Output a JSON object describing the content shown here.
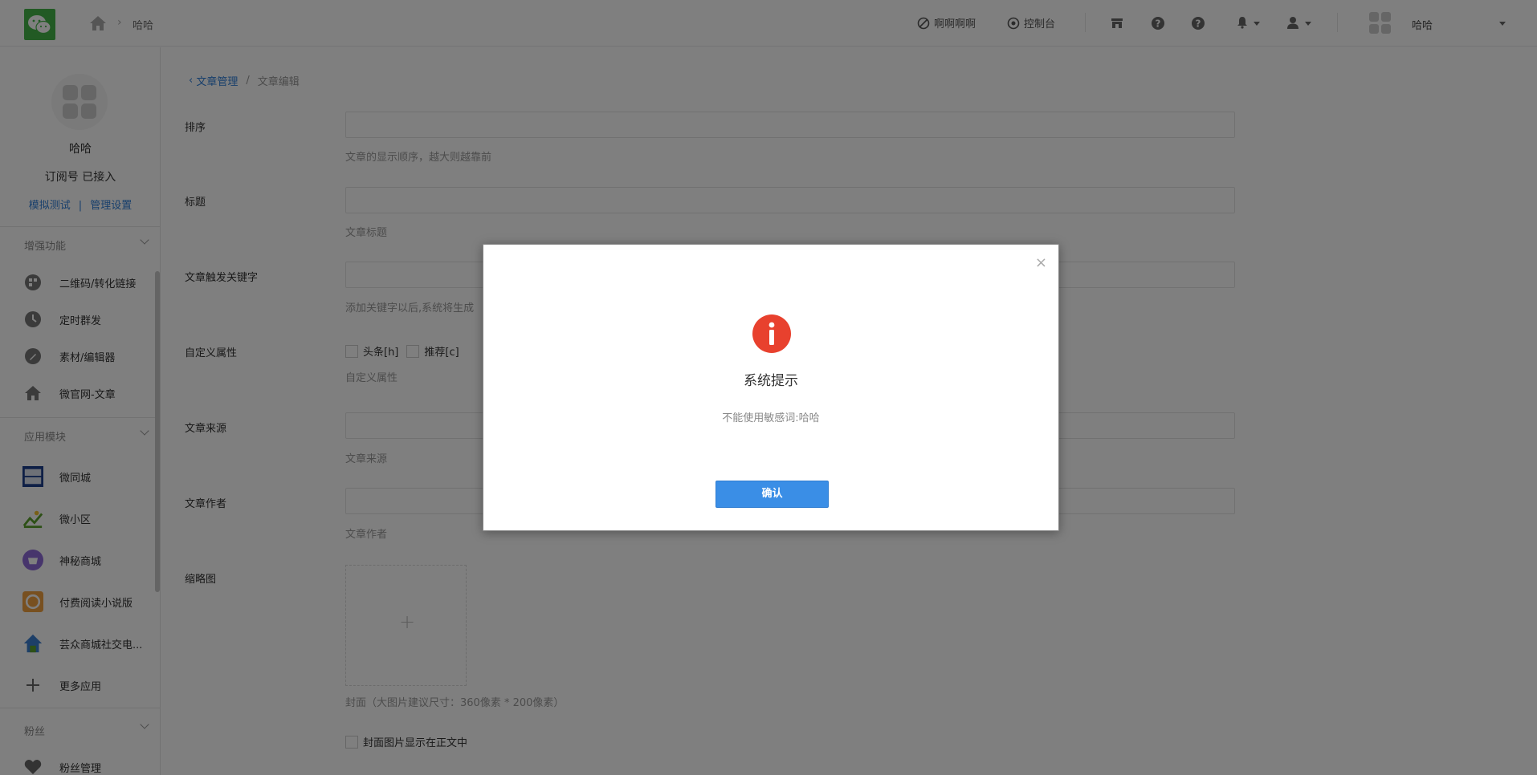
{
  "header": {
    "breadcrumb_current": "哈哈",
    "link_1": "啊啊啊啊",
    "link_2": "控制台",
    "account_name": "哈哈"
  },
  "sidebar": {
    "account_name": "哈哈",
    "account_type": "订阅号 已接入",
    "link_test": "模拟测试",
    "link_manage": "管理设置",
    "groups": [
      {
        "title": "增强功能",
        "items": [
          {
            "label": "二维码/转化链接",
            "icon": "qrcode-icon"
          },
          {
            "label": "定时群发",
            "icon": "clock-icon"
          },
          {
            "label": "素材/编辑器",
            "icon": "pencil-icon"
          },
          {
            "label": "微官网-文章",
            "icon": "home-icon"
          }
        ]
      },
      {
        "title": "应用模块",
        "items": [
          {
            "label": "微同城",
            "icon": "city-app-icon"
          },
          {
            "label": "微小区",
            "icon": "community-app-icon"
          },
          {
            "label": "神秘商城",
            "icon": "mall-app-icon"
          },
          {
            "label": "付费阅读小说版",
            "icon": "novel-app-icon"
          },
          {
            "label": "芸众商城社交电...",
            "icon": "shop-app-icon"
          },
          {
            "label": "更多应用",
            "icon": "plus-icon"
          }
        ]
      },
      {
        "title": "粉丝",
        "items": [
          {
            "label": "粉丝管理",
            "icon": "heart-icon"
          }
        ]
      }
    ]
  },
  "main": {
    "breadcrumb_back": "文章管理",
    "breadcrumb_sep": "/",
    "breadcrumb_current": "文章编辑",
    "fields": [
      {
        "label": "排序",
        "help": "文章的显示顺序，越大则越靠前"
      },
      {
        "label": "标题",
        "help": "文章标题"
      },
      {
        "label": "文章触发关键字",
        "help": "添加关键字以后,系统将生成"
      },
      {
        "label": "自定义属性",
        "help": "自定义属性"
      },
      {
        "label": "文章来源",
        "help": "文章来源"
      },
      {
        "label": "文章作者",
        "help": "文章作者"
      },
      {
        "label": "缩略图",
        "help": "封面（大图片建议尺寸：360像素 * 200像素）"
      }
    ],
    "checkboxes": [
      "头条[h]",
      "推荐[c]"
    ],
    "cover_in_body": "封面图片显示在正文中",
    "thumb_plus": "+"
  },
  "modal": {
    "close": "×",
    "title": "系统提示",
    "message": "不能使用敏感词:哈哈",
    "confirm": "确认",
    "accent_color": "#e8412e",
    "button_color": "#3a8ee6"
  }
}
